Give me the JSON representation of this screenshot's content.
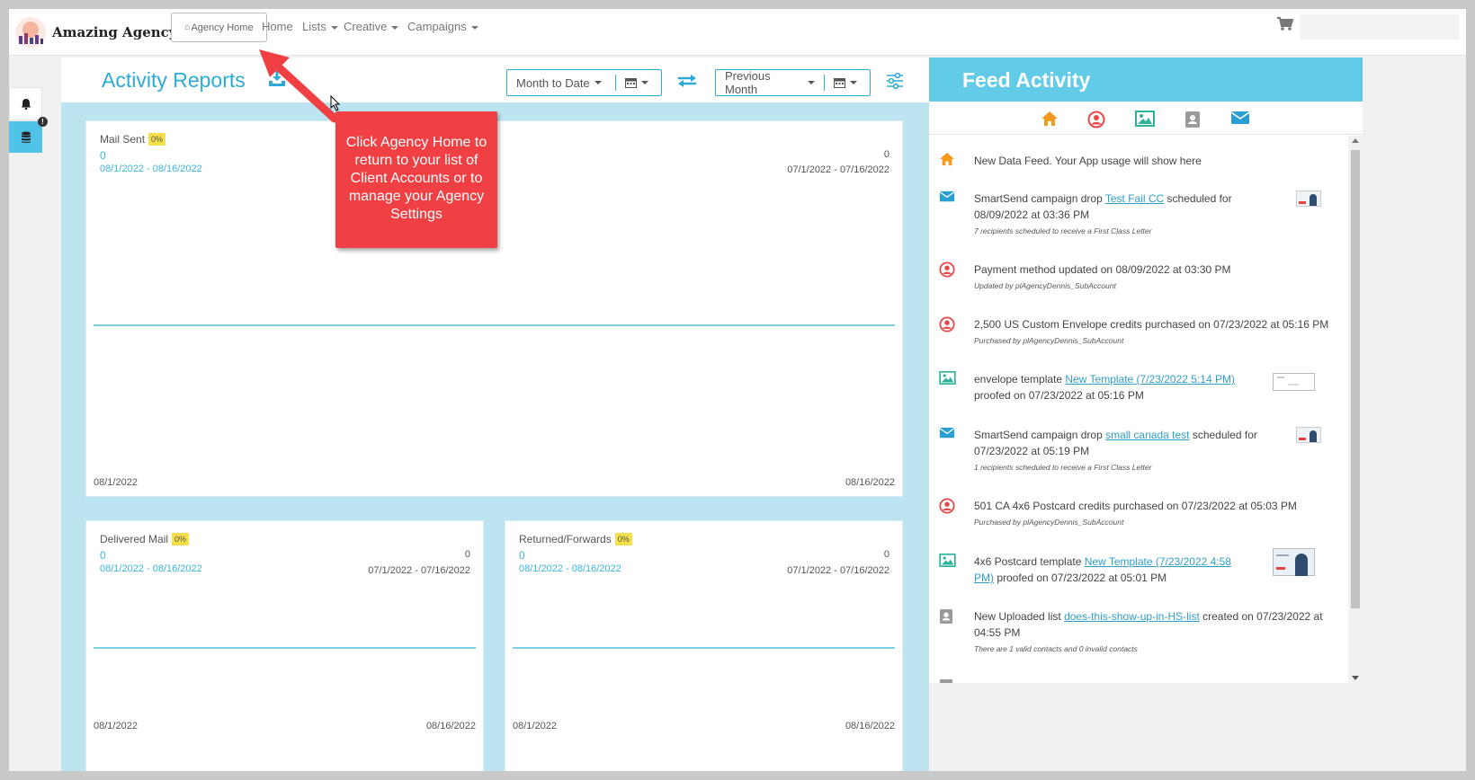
{
  "brand": {
    "name": "Amazing Agency"
  },
  "nav": {
    "agency_home": "Agency Home",
    "home": "Home",
    "lists": "Lists",
    "creative": "Creative",
    "campaigns": "Campaigns"
  },
  "sidebar": {
    "alert_badge": "!"
  },
  "reports": {
    "title": "Activity Reports",
    "current_period": "Month to Date",
    "compare_period": "Previous Month",
    "cards": [
      {
        "label": "Mail Sent",
        "badge": "0%",
        "current_value": "0",
        "current_range": "08/1/2022 - 08/16/2022",
        "previous_value": "0",
        "previous_range": "07/1/2022 - 07/16/2022",
        "axis_start": "08/1/2022",
        "axis_end": "08/16/2022"
      },
      {
        "label": "Delivered Mail",
        "badge": "0%",
        "current_value": "0",
        "current_range": "08/1/2022 - 08/16/2022",
        "previous_value": "0",
        "previous_range": "07/1/2022 - 07/16/2022",
        "axis_start": "08/1/2022",
        "axis_end": "08/16/2022"
      },
      {
        "label": "Returned/Forwards",
        "badge": "0%",
        "current_value": "0",
        "current_range": "08/1/2022 - 08/16/2022",
        "previous_value": "0",
        "previous_range": "07/1/2022 - 07/16/2022",
        "axis_start": "08/1/2022",
        "axis_end": "08/16/2022"
      }
    ]
  },
  "callout": {
    "text": "Click Agency Home to return to your list of Client Accounts or to manage your Agency Settings"
  },
  "feed": {
    "title": "Feed Activity",
    "items": [
      {
        "icon": "home-icon",
        "pre": "New Data Feed. Your App usage will show here"
      },
      {
        "icon": "envelope-icon",
        "pre": "SmartSend campaign drop ",
        "link": "Test Fail CC",
        "post": " scheduled for 08/09/2022 at 03:36 PM",
        "sub": "7 recipients scheduled to receive a First Class Letter"
      },
      {
        "icon": "user-icon",
        "pre": "Payment method updated on 08/09/2022 at 03:30 PM",
        "sub": "Updated by plAgencyDennis_SubAccount"
      },
      {
        "icon": "user-icon",
        "pre": "2,500 US Custom Envelope credits purchased on 07/23/2022 at 05:16 PM",
        "sub": "Purchased by plAgencyDennis_SubAccount"
      },
      {
        "icon": "image-icon",
        "pre": "envelope template ",
        "link": "New Template (7/23/2022 5:14 PM)",
        "post": " proofed on 07/23/2022 at 05:16 PM"
      },
      {
        "icon": "envelope-icon",
        "pre": "SmartSend campaign drop ",
        "link": "small canada test",
        "post": " scheduled for 07/23/2022 at 05:19 PM",
        "sub": "1 recipients scheduled to receive a First Class Letter"
      },
      {
        "icon": "user-icon",
        "pre": "501 CA 4x6 Postcard credits purchased on 07/23/2022 at 05:03 PM",
        "sub": "Purchased by plAgencyDennis_SubAccount"
      },
      {
        "icon": "image-icon",
        "pre": "4x6 Postcard template ",
        "link": "New Template (7/23/2022 4:58 PM)",
        "post": " proofed on 07/23/2022 at 05:01 PM"
      },
      {
        "icon": "contact-icon",
        "pre": "New Uploaded list ",
        "link": "does-this-show-up-in-HS-list",
        "post": " created on 07/23/2022 at 04:55 PM",
        "sub": "There are 1 valid contacts and 0 invalid contacts"
      }
    ]
  },
  "colors": {
    "accent": "#2eaad6",
    "feed_header": "#62cbe8",
    "callout": "#f04043",
    "badge": "#f5e04a",
    "home_icon": "#f39a1e",
    "user_icon": "#e8474a",
    "image_icon": "#2eb39b",
    "envelope_icon": "#2a9fd6",
    "contact_icon": "#9a9a9a"
  }
}
